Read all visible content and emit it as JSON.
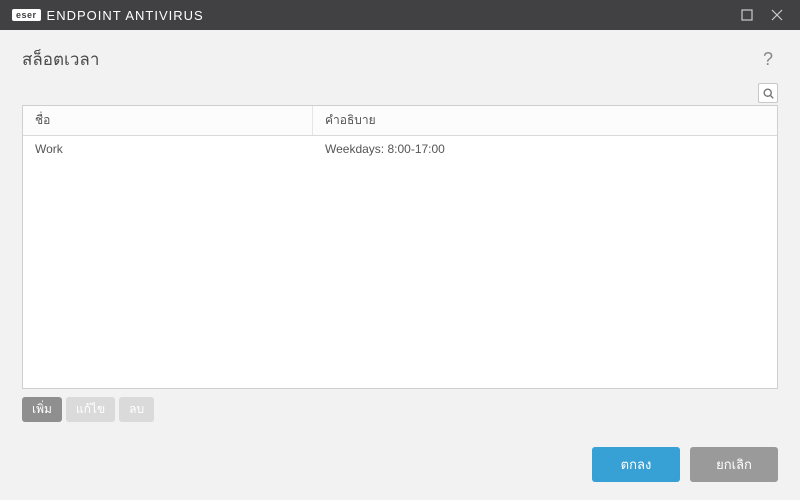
{
  "titlebar": {
    "brand_badge": "eser",
    "brand_text": "ENDPOINT ANTIVIRUS"
  },
  "header": {
    "title": "สล็อตเวลา",
    "help": "?"
  },
  "table": {
    "columns": {
      "name": "ชื่อ",
      "description": "คำอธิบาย"
    },
    "rows": [
      {
        "name": "Work",
        "description": "Weekdays: 8:00-17:00"
      }
    ]
  },
  "actions": {
    "add": "เพิ่ม",
    "edit": "แก้ไข",
    "delete": "ลบ"
  },
  "footer": {
    "ok": "ตกลง",
    "cancel": "ยกเลิก"
  }
}
